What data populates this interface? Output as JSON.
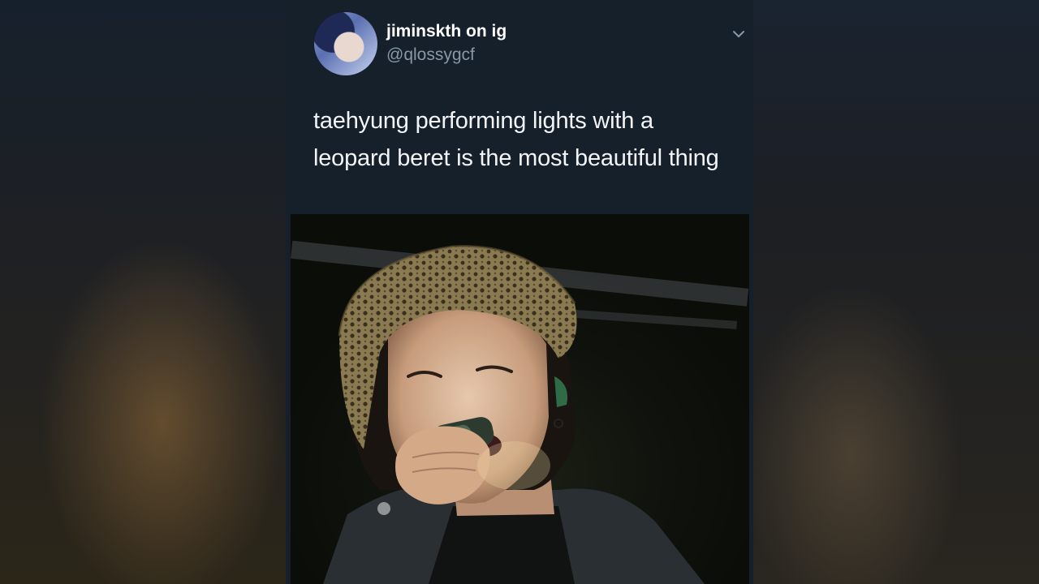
{
  "tweet": {
    "display_name": "jiminskth on ig",
    "handle": "@qlossygcf",
    "text": "taehyung performing lights with a leopard beret is the most beautiful thing",
    "menu_icon": "chevron-down-icon"
  },
  "colors": {
    "card_background": "#15202b",
    "name_text": "#ffffff",
    "handle_text": "#8899a6",
    "body_text": "#f2f4f6"
  }
}
